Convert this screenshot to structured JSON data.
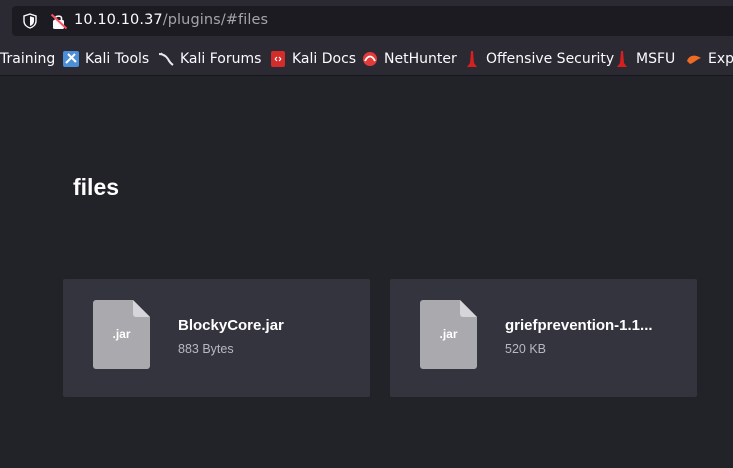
{
  "browser": {
    "url_host": "10.10.10.37",
    "url_path": "/plugins/#files",
    "bookmarks": [
      {
        "label": "Training",
        "icon": "none"
      },
      {
        "label": "Kali Tools",
        "icon": "kali-tools-icon"
      },
      {
        "label": "Kali Forums",
        "icon": "kali-dragon-icon"
      },
      {
        "label": "Kali Docs",
        "icon": "kali-docs-icon"
      },
      {
        "label": "NetHunter",
        "icon": "nethunter-icon"
      },
      {
        "label": "Offensive Security",
        "icon": "offsec-icon"
      },
      {
        "label": "MSFU",
        "icon": "offsec-icon"
      },
      {
        "label": "Exp",
        "icon": "exploit-db-icon"
      }
    ]
  },
  "page": {
    "title": "files",
    "files": [
      {
        "ext": ".jar",
        "name": "BlockyCore.jar",
        "size": "883 Bytes"
      },
      {
        "ext": ".jar",
        "name": "griefprevention-1.1...",
        "size": "520 KB"
      }
    ]
  },
  "colors": {
    "page_bg": "#222229",
    "card_bg": "#34343e",
    "file_icon": "#a9a9ae",
    "toolbar_bg": "#2b2a33"
  }
}
